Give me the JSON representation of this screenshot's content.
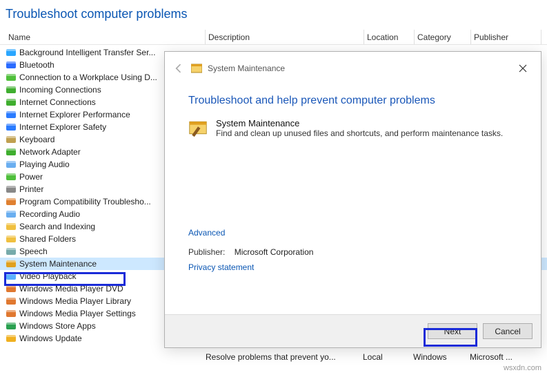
{
  "page_title": "Troubleshoot computer problems",
  "columns": {
    "name": "Name",
    "description": "Description",
    "location": "Location",
    "category": "Category",
    "publisher": "Publisher"
  },
  "items": [
    {
      "label": "Background Intelligent Transfer Ser...",
      "icon": "bits-icon"
    },
    {
      "label": "Bluetooth",
      "icon": "bluetooth-icon"
    },
    {
      "label": "Connection to a Workplace Using D...",
      "icon": "workplace-icon"
    },
    {
      "label": "Incoming Connections",
      "icon": "incoming-icon"
    },
    {
      "label": "Internet Connections",
      "icon": "internet-icon"
    },
    {
      "label": "Internet Explorer Performance",
      "icon": "ie-perf-icon"
    },
    {
      "label": "Internet Explorer Safety",
      "icon": "ie-safety-icon"
    },
    {
      "label": "Keyboard",
      "icon": "keyboard-icon"
    },
    {
      "label": "Network Adapter",
      "icon": "netadapter-icon"
    },
    {
      "label": "Playing Audio",
      "icon": "audio-icon"
    },
    {
      "label": "Power",
      "icon": "power-icon"
    },
    {
      "label": "Printer",
      "icon": "printer-icon"
    },
    {
      "label": "Program Compatibility Troublesho...",
      "icon": "compat-icon"
    },
    {
      "label": "Recording Audio",
      "icon": "recaudio-icon"
    },
    {
      "label": "Search and Indexing",
      "icon": "search-icon"
    },
    {
      "label": "Shared Folders",
      "icon": "folders-icon"
    },
    {
      "label": "Speech",
      "icon": "speech-icon"
    },
    {
      "label": "System Maintenance",
      "icon": "sysmaint-icon",
      "selected": true
    },
    {
      "label": "Video Playback",
      "icon": "video-icon"
    },
    {
      "label": "Windows Media Player DVD",
      "icon": "wmp-dvd-icon"
    },
    {
      "label": "Windows Media Player Library",
      "icon": "wmp-lib-icon"
    },
    {
      "label": "Windows Media Player Settings",
      "icon": "wmp-set-icon"
    },
    {
      "label": "Windows Store Apps",
      "icon": "store-icon"
    },
    {
      "label": "Windows Update",
      "icon": "update-icon"
    }
  ],
  "visible_row": {
    "description": "Resolve problems that prevent yo...",
    "location": "Local",
    "category": "Windows",
    "publisher": "Microsoft ..."
  },
  "dialog": {
    "breadcrumb": "System Maintenance",
    "heading": "Troubleshoot and help prevent computer problems",
    "item_title": "System Maintenance",
    "item_desc": "Find and clean up unused files and shortcuts, and perform maintenance tasks.",
    "advanced": "Advanced",
    "publisher_label": "Publisher:",
    "publisher_value": "Microsoft Corporation",
    "privacy": "Privacy statement",
    "next": "Next",
    "cancel": "Cancel"
  },
  "watermark": "wsxdn.com"
}
